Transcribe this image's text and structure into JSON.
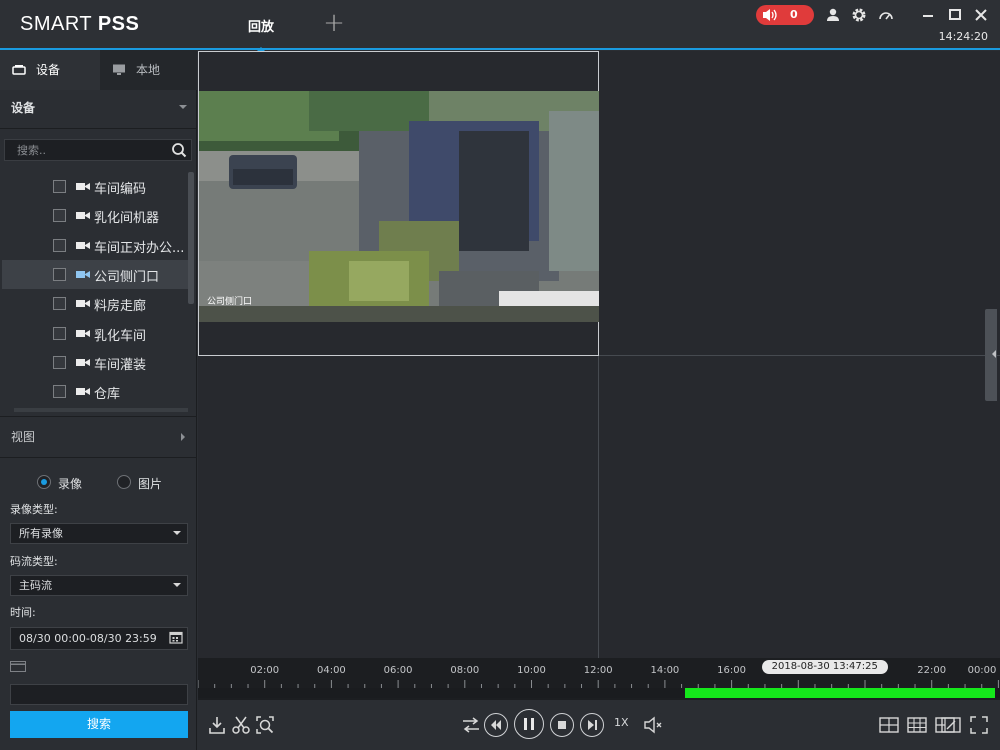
{
  "app": {
    "logo_light": "SMART",
    "logo_bold": "PSS",
    "active_tab": "回放",
    "alarm_count": "0",
    "clock": "14:24:20"
  },
  "sidebar": {
    "tabs": [
      {
        "label": "设备",
        "icon": "device-icon",
        "active": true
      },
      {
        "label": "本地",
        "icon": "monitor-icon",
        "active": false
      }
    ],
    "device_section": "设备",
    "search_placeholder": "搜索..",
    "devices": [
      {
        "name": "车间编码",
        "selected": false
      },
      {
        "name": "乳化间机器",
        "selected": false
      },
      {
        "name": "车间正对办公...",
        "selected": false
      },
      {
        "name": "公司侧门口",
        "selected": true
      },
      {
        "name": "料房走廊",
        "selected": false
      },
      {
        "name": "乳化车间",
        "selected": false
      },
      {
        "name": "车间灌装",
        "selected": false
      },
      {
        "name": "仓库",
        "selected": false
      }
    ],
    "view_section": "视图",
    "mode_options": [
      {
        "label": "录像",
        "checked": true
      },
      {
        "label": "图片",
        "checked": false
      }
    ],
    "record_type_label": "录像类型:",
    "record_type_value": "所有录像",
    "stream_type_label": "码流类型:",
    "stream_type_value": "主码流",
    "time_label": "时间:",
    "time_value": "08/30 00:00-08/30 23:59",
    "search_button": "搜索"
  },
  "video": {
    "overlay_text": "公司侧门口"
  },
  "timeline": {
    "hour_labels": [
      "02:00",
      "04:00",
      "06:00",
      "08:00",
      "10:00",
      "12:00",
      "14:00",
      "16:00",
      "18:00",
      "20:00",
      "22:00",
      "00:00"
    ],
    "cursor_text": "2018-08-30 13:47:25",
    "recording_start_hour": 14.6,
    "recording_end_hour": 23.9,
    "recording_color": "#15e81b"
  },
  "toolbar": {
    "speed": "1X"
  },
  "colors": {
    "accent": "#1a9be0",
    "alarm": "#e03b3b",
    "button": "#13a6f0"
  }
}
